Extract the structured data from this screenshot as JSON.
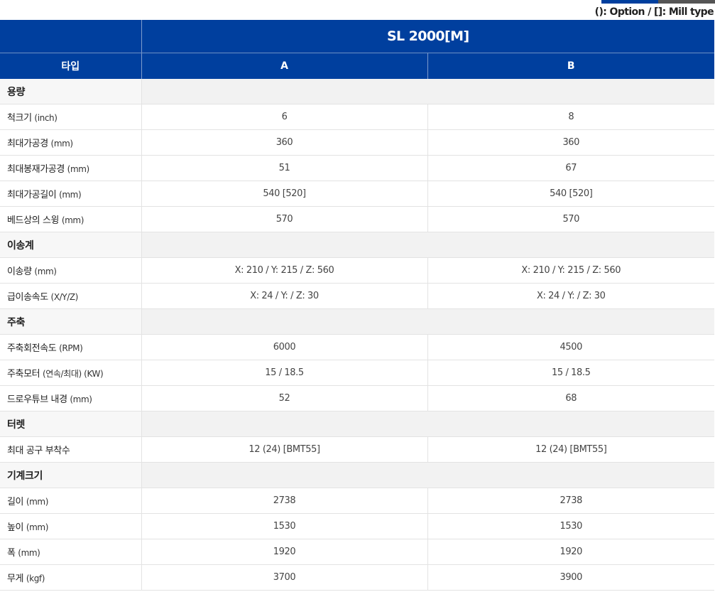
{
  "legend": "(): Option / []: Mill type",
  "header": {
    "model": "SL 2000[M]",
    "type_label": "타입",
    "col_a": "A",
    "col_b": "B"
  },
  "colors": {
    "header_bg": "#003f9e",
    "section_bg": "#f2f2f2",
    "accent_dark": "#555555"
  },
  "rows": [
    {
      "kind": "section",
      "label": "용량"
    },
    {
      "kind": "spec",
      "name": "척크기",
      "unit": "(inch)",
      "a": "6",
      "b": "8"
    },
    {
      "kind": "spec",
      "name": "최대가공경",
      "unit": "(mm)",
      "a": "360",
      "b": "360"
    },
    {
      "kind": "spec",
      "name": "최대봉재가공경",
      "unit": "(mm)",
      "a": "51",
      "b": "67"
    },
    {
      "kind": "spec",
      "name": "최대가공길이",
      "unit": "(mm)",
      "a": "540 [520]",
      "b": "540 [520]"
    },
    {
      "kind": "spec",
      "name": "베드상의 스윙",
      "unit": "(mm)",
      "a": "570",
      "b": "570"
    },
    {
      "kind": "section",
      "label": "이송계"
    },
    {
      "kind": "spec",
      "name": "이송량",
      "unit": "(mm)",
      "a": "X: 210 / Y: 215 / Z: 560",
      "b": "X: 210 / Y: 215 / Z: 560"
    },
    {
      "kind": "spec",
      "name": "급이송속도",
      "unit": "(X/Y/Z)",
      "a": "X: 24 / Y: / Z: 30",
      "b": "X: 24 / Y: / Z: 30"
    },
    {
      "kind": "section",
      "label": "주축"
    },
    {
      "kind": "spec",
      "name": "주축회전속도",
      "unit": "(RPM)",
      "a": "6000",
      "b": "4500"
    },
    {
      "kind": "spec",
      "name": "주축모터",
      "unit": "(연속/최대) (KW)",
      "a": "15 / 18.5",
      "b": "15 / 18.5"
    },
    {
      "kind": "spec",
      "name": "드로우튜브 내경",
      "unit": "(mm)",
      "a": "52",
      "b": "68"
    },
    {
      "kind": "section",
      "label": "터렛"
    },
    {
      "kind": "spec",
      "name": "최대 공구 부착수",
      "unit": "",
      "a": "12 (24) [BMT55]",
      "b": "12 (24) [BMT55]"
    },
    {
      "kind": "section",
      "label": "기계크기"
    },
    {
      "kind": "spec",
      "name": "길이",
      "unit": "(mm)",
      "a": "2738",
      "b": "2738"
    },
    {
      "kind": "spec",
      "name": "높이",
      "unit": "(mm)",
      "a": "1530",
      "b": "1530"
    },
    {
      "kind": "spec",
      "name": "폭",
      "unit": "(mm)",
      "a": "1920",
      "b": "1920"
    },
    {
      "kind": "spec",
      "name": "무게",
      "unit": "(kgf)",
      "a": "3700",
      "b": "3900"
    }
  ]
}
